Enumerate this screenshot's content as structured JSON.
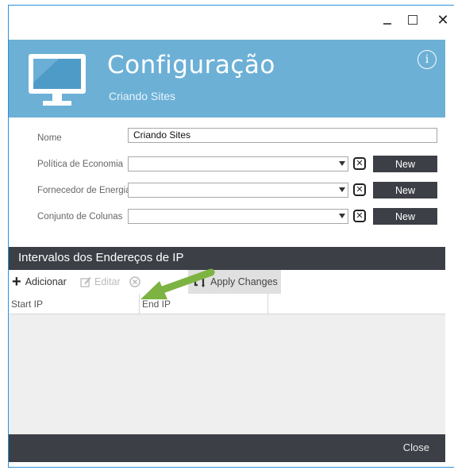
{
  "window": {
    "close_glyph": "✕"
  },
  "header": {
    "title": "Configuração",
    "subtitle": "Criando Sites",
    "info_glyph": "i"
  },
  "form": {
    "name_label": "Nome",
    "name_value": "Criando Sites",
    "economy_label": "Política de Economia",
    "energy_label": "Fornecedor de Energia",
    "columns_label": "Conjunto de Colunas",
    "clear_glyph": "✕",
    "new_label": "New"
  },
  "section": {
    "title": "Intervalos dos Endereços de IP"
  },
  "toolbar": {
    "add_label": "Adicionar",
    "edit_label": "Editar",
    "apply_label": "Apply Changes"
  },
  "grid": {
    "columns": [
      "Start IP",
      "End IP"
    ],
    "rows": []
  },
  "footer": {
    "close_label": "Close"
  },
  "colors": {
    "header_bg": "#6cb0d6",
    "dark_bar": "#3c3f46",
    "arrow": "#7cb342"
  },
  "icons": {
    "monitor": "monitor-icon",
    "info": "info-icon",
    "add": "plus-icon",
    "edit": "edit-icon",
    "delete": "delete-icon",
    "apply": "refresh-icon",
    "clear": "clear-icon",
    "dropdown": "chevron-down-icon"
  }
}
